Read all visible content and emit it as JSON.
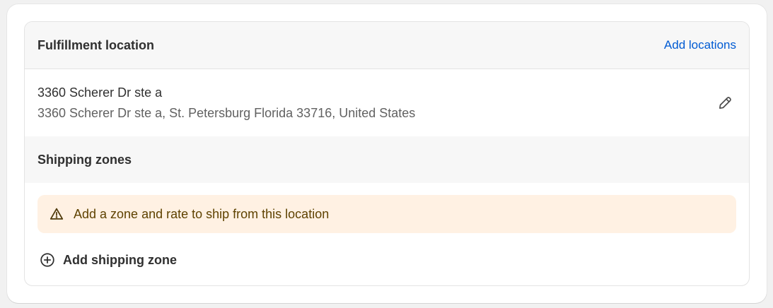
{
  "location": {
    "section_title": "Fulfillment location",
    "add_locations_label": "Add locations",
    "address_name": "3360 Scherer Dr ste a",
    "address_full": "3360 Scherer Dr ste a, St. Petersburg Florida 33716, United States",
    "edit_icon": "pencil-icon"
  },
  "shipping_zones": {
    "section_title": "Shipping zones",
    "warning": {
      "icon": "warning-triangle-icon",
      "text": "Add a zone and rate to ship from this location",
      "background": "#fff1e3",
      "text_color": "#5e4200"
    },
    "add_zone": {
      "icon": "plus-circle-icon",
      "label": "Add shipping zone"
    }
  },
  "colors": {
    "link": "#005bd3",
    "header_bg": "#f7f7f7",
    "text_primary": "#303030",
    "text_secondary": "#616161"
  }
}
